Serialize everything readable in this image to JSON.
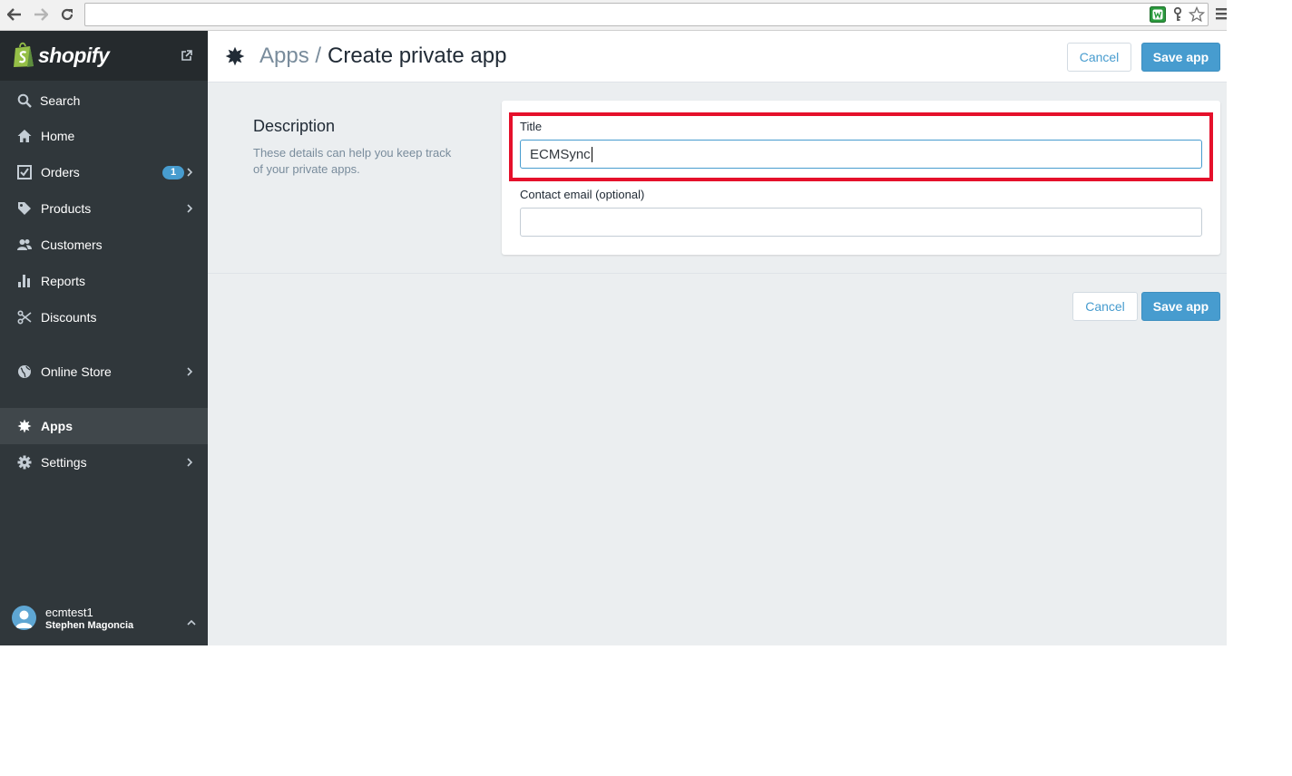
{
  "browser": {
    "address": "",
    "icons": [
      "back-arrow-icon",
      "forward-arrow-icon",
      "reload-icon",
      "extension-shield-icon",
      "key-icon",
      "star-icon",
      "chrome-menu-icon"
    ]
  },
  "sidebar": {
    "brand": "shopify",
    "items": [
      {
        "label": "Search",
        "icon": "search-icon"
      },
      {
        "label": "Home",
        "icon": "home-icon"
      },
      {
        "label": "Orders",
        "icon": "orders-icon",
        "badge": "1"
      },
      {
        "label": "Products",
        "icon": "tag-icon"
      },
      {
        "label": "Customers",
        "icon": "customers-icon"
      },
      {
        "label": "Reports",
        "icon": "bar-chart-icon"
      },
      {
        "label": "Discounts",
        "icon": "scissors-icon"
      },
      {
        "label": "Online Store",
        "icon": "globe-icon"
      },
      {
        "label": "Apps",
        "icon": "puzzle-icon",
        "active": true
      },
      {
        "label": "Settings",
        "icon": "gear-icon"
      }
    ],
    "user": {
      "store": "ecmtest1",
      "name": "Stephen Magoncia"
    }
  },
  "header": {
    "breadcrumb": "Apps /",
    "title": "Create private app",
    "cancel_label": "Cancel",
    "save_label": "Save app"
  },
  "form": {
    "section_title": "Description",
    "section_desc": "These details can help you keep track of your private apps.",
    "title_label": "Title",
    "title_value": "ECMSync",
    "email_label": "Contact email (optional)",
    "email_value": ""
  },
  "footer": {
    "cancel_label": "Cancel",
    "save_label": "Save app"
  },
  "colors": {
    "sidebar_bg": "#30373b",
    "accent": "#479ccf",
    "highlight": "#e5102b",
    "page_bg": "#ebeef0"
  }
}
